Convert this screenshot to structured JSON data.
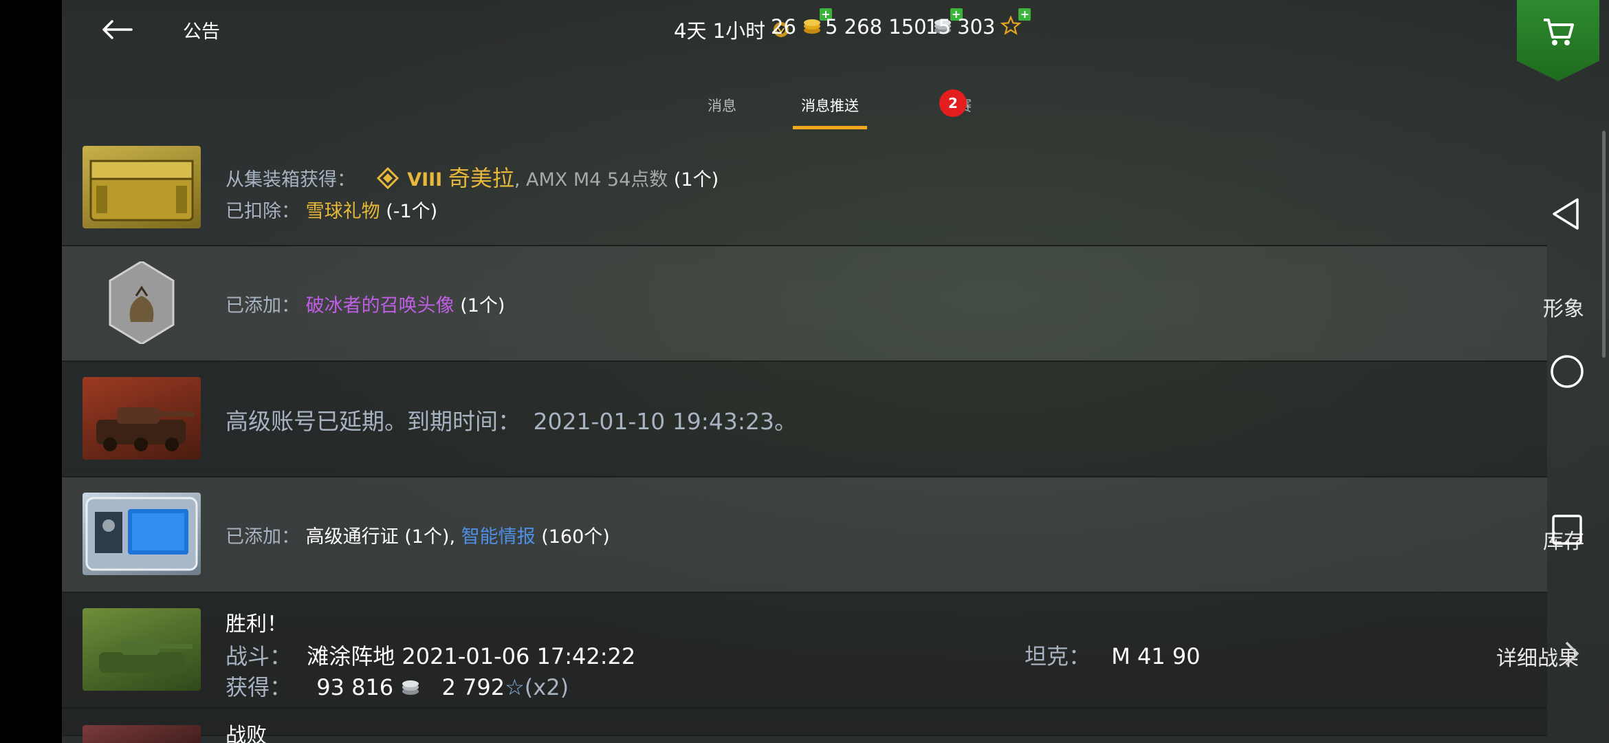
{
  "header": {
    "title": "公告",
    "timer": "4天 1小时",
    "gold": "26",
    "credits": "5 268 150",
    "free_xp": "15 303"
  },
  "tabs": [
    {
      "label": "消息"
    },
    {
      "label": "消息推送",
      "badge": "2"
    },
    {
      "label": "联赛"
    }
  ],
  "messages": {
    "m1": {
      "line1_prefix": "从集装箱获得：",
      "tier": "VIII",
      "vehicle": "奇美拉",
      "sep": ",",
      "item": "AMX M4 54点数",
      "qty": "(1个)",
      "line2_prefix": "已扣除：",
      "line2_item": "雪球礼物",
      "line2_qty": "(-1个)"
    },
    "m2": {
      "prefix": "已添加：",
      "item": "破冰者的召唤头像",
      "qty": "(1个)"
    },
    "m3": {
      "text": "高级账号已延期。到期时间：",
      "date": "2021-01-10 19:43:23。"
    },
    "m4": {
      "prefix": "已添加：",
      "item1": "高级通行证",
      "qty1": "(1个)",
      "sep": ",",
      "item2": "智能情报",
      "qty2": "(160个)"
    },
    "m5": {
      "title": "胜利！",
      "battle_label": "战斗：",
      "battle_value": "滩涂阵地 2021-01-06 17:42:22",
      "tank_label": "坦克：",
      "tank_value": "M 41 90",
      "reward_label": "获得：",
      "credits": "93 816",
      "xp": "2 792",
      "multiplier": "(x2)",
      "details": "详细战果"
    },
    "m6": {
      "title": "战败"
    }
  },
  "side_nav": {
    "label1": "形象",
    "label2": "库存"
  },
  "colors": {
    "accent_tab": "#f0a81c",
    "badge": "#e41e1e",
    "gold_text": "#e7b83a",
    "purple_text": "#c15ee8",
    "blue_text": "#4f8fe8",
    "shop_green": "#2e8b2e"
  }
}
